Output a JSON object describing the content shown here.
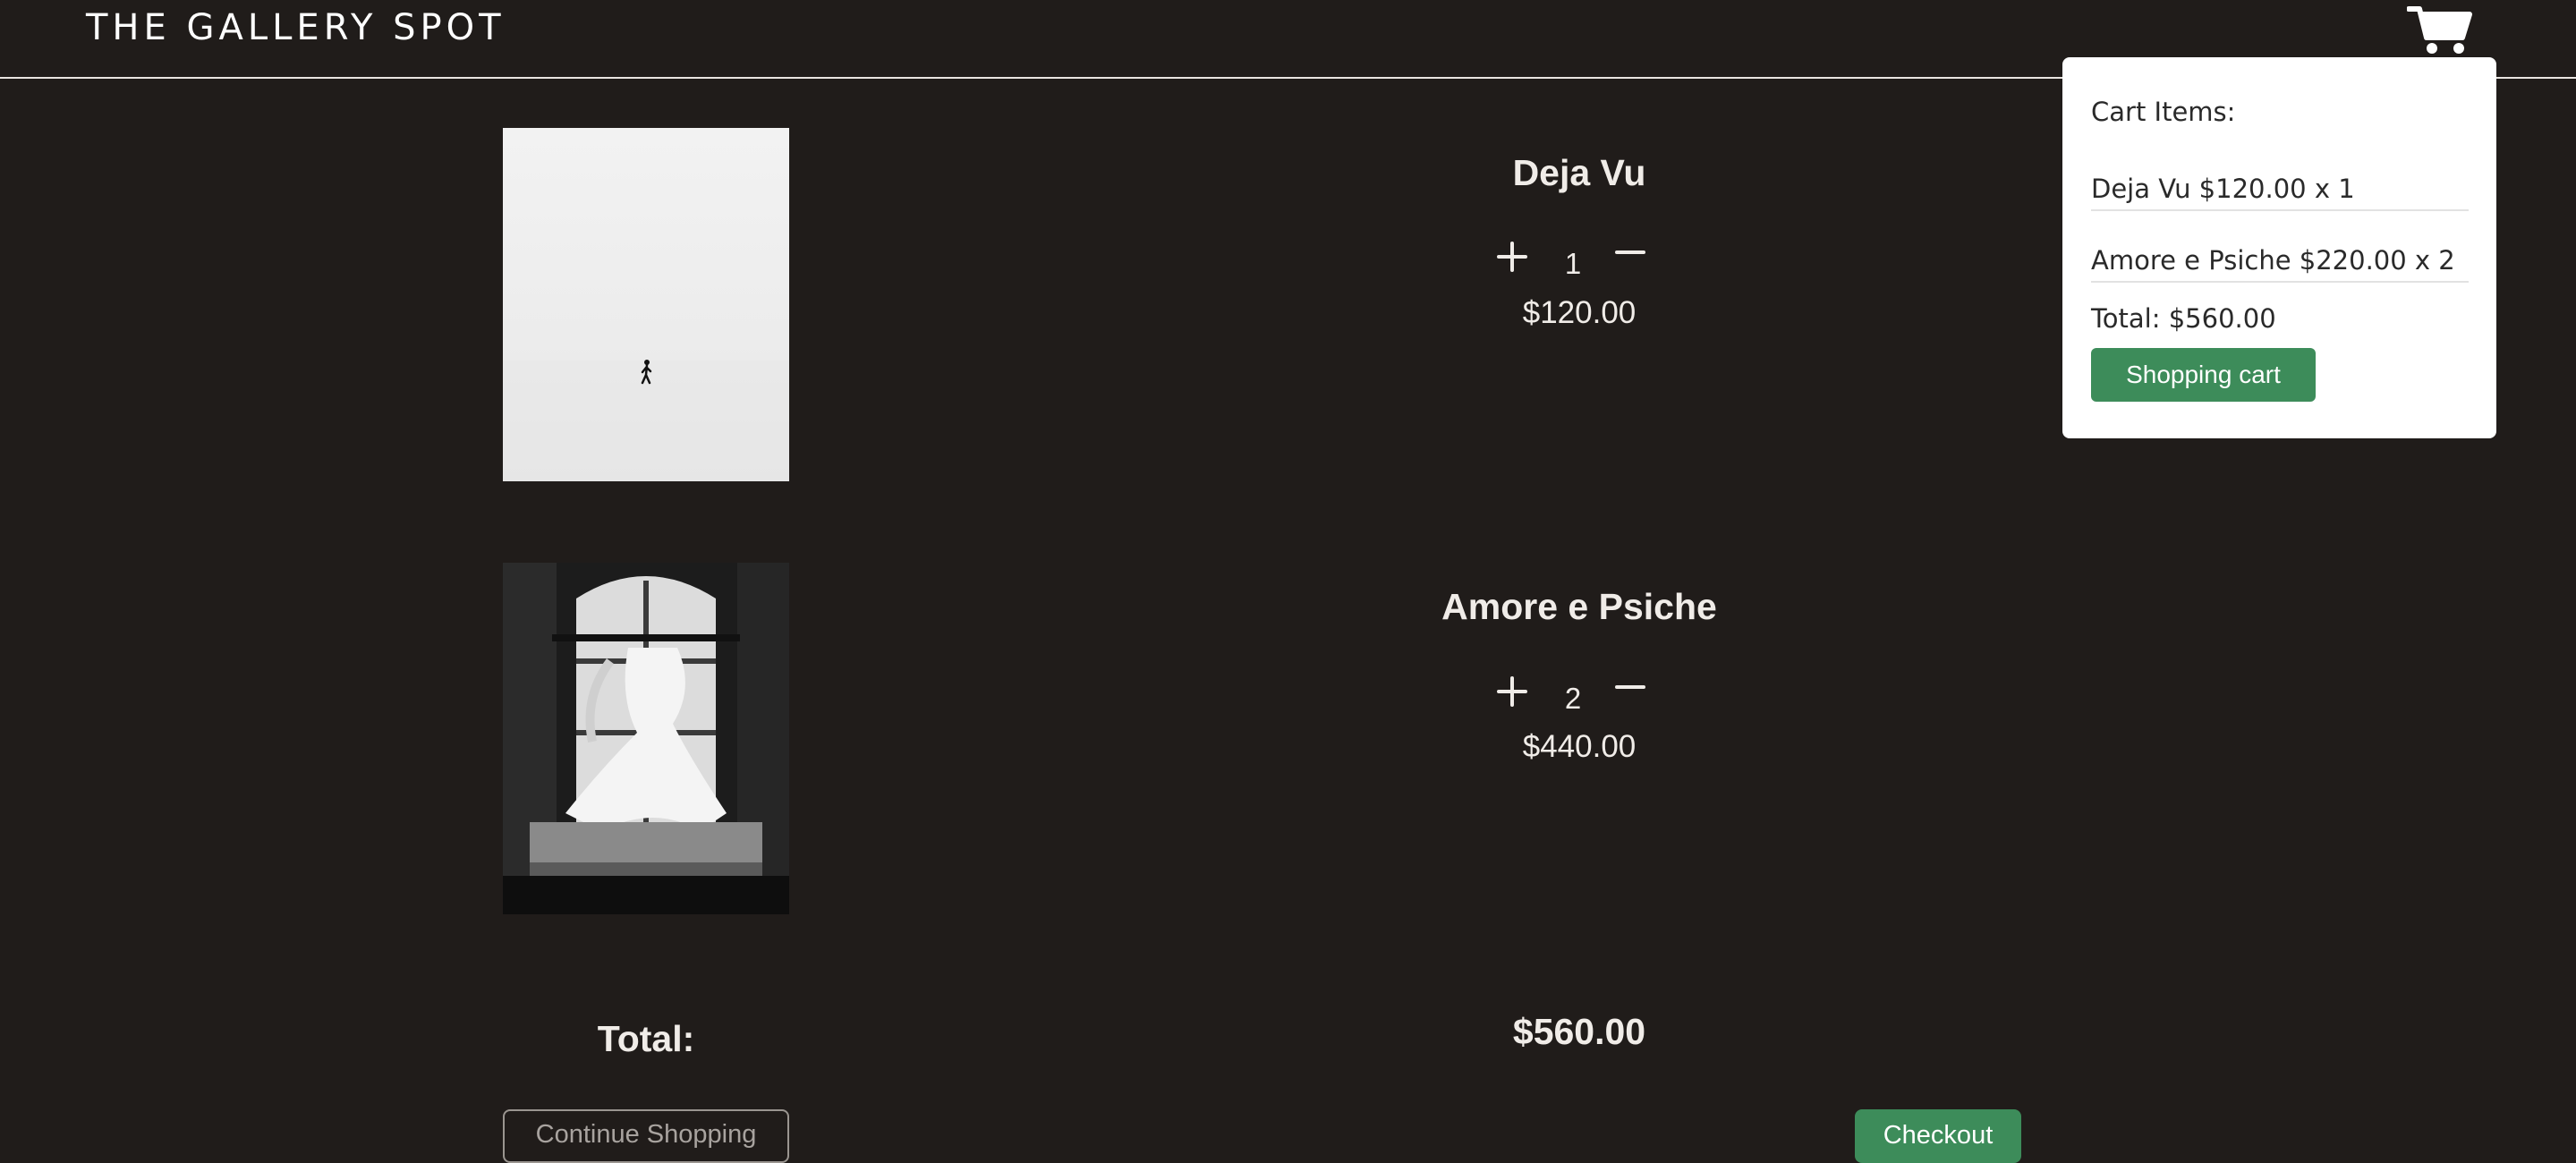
{
  "header": {
    "brand": "THE GALLERY SPOT",
    "cart_icon": "shopping-cart-icon"
  },
  "cart_items": [
    {
      "name": "Deja Vu",
      "quantity": "1",
      "price": "$120.00",
      "image": "figure-in-white-fog-photo"
    },
    {
      "name": "Amore e Psiche",
      "quantity": "2",
      "price": "$440.00",
      "image": "cupid-psyche-statue-photo"
    }
  ],
  "summary": {
    "total_label": "Total:",
    "total_value": "$560.00",
    "continue_label": "Continue Shopping",
    "checkout_label": "Checkout"
  },
  "dropdown": {
    "title": "Cart Items:",
    "lines": [
      "Deja Vu $120.00 x 1",
      "Amore e Psiche $220.00 x 2"
    ],
    "total": "Total: $560.00",
    "button_label": "Shopping cart"
  },
  "colors": {
    "background": "#201c1a",
    "accent": "#3d8c5a",
    "text": "#f0ece8"
  }
}
